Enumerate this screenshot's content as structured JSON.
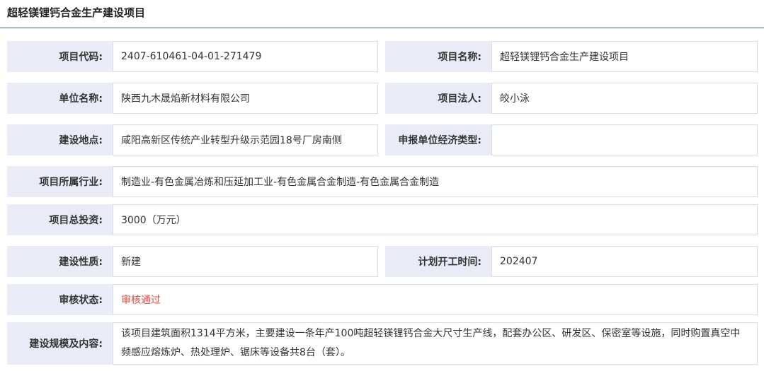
{
  "header": {
    "title": "超轻镁锂钙合金生产建设项目"
  },
  "fields": {
    "project_code": {
      "label": "项目代码:",
      "value": "2407-610461-04-01-271479"
    },
    "project_name": {
      "label": "项目名称:",
      "value": "超轻镁锂钙合金生产建设项目"
    },
    "unit_name": {
      "label": "单位名称:",
      "value": "陕西九木晟焰新材料有限公司"
    },
    "legal_person": {
      "label": "项目法人:",
      "value": "皎小泳"
    },
    "location": {
      "label": "建设地点:",
      "value": "咸阳高新区传统产业转型升级示范园18号厂房南侧"
    },
    "economic_type": {
      "label": "申报单位经济类型:",
      "value": ""
    },
    "industry": {
      "label": "项目所属行业:",
      "value": "制造业-有色金属冶炼和压延加工业-有色金属合金制造-有色金属合金制造"
    },
    "total_investment": {
      "label": "项目总投资:",
      "value": "3000（万元）"
    },
    "nature": {
      "label": "建设性质:",
      "value": "新建"
    },
    "start_time": {
      "label": "计划开工时间:",
      "value": "202407"
    },
    "review_status": {
      "label": "审核状态:",
      "value": "审核通过"
    },
    "scale_content": {
      "label": "建设规模及内容:",
      "value": "该项目建筑面积1314平方米，主要建设一条年产100吨超轻镁锂钙合金大尺寸生产线，配套办公区、研发区、保密室等设施，同时购置真空中频感应熔炼炉、热处理炉、锯床等设备共8台（套）。"
    }
  },
  "colors": {
    "label_bg": "#e9ecf7",
    "status": "#e74c3c",
    "header_rule": "#2d6b6e"
  }
}
